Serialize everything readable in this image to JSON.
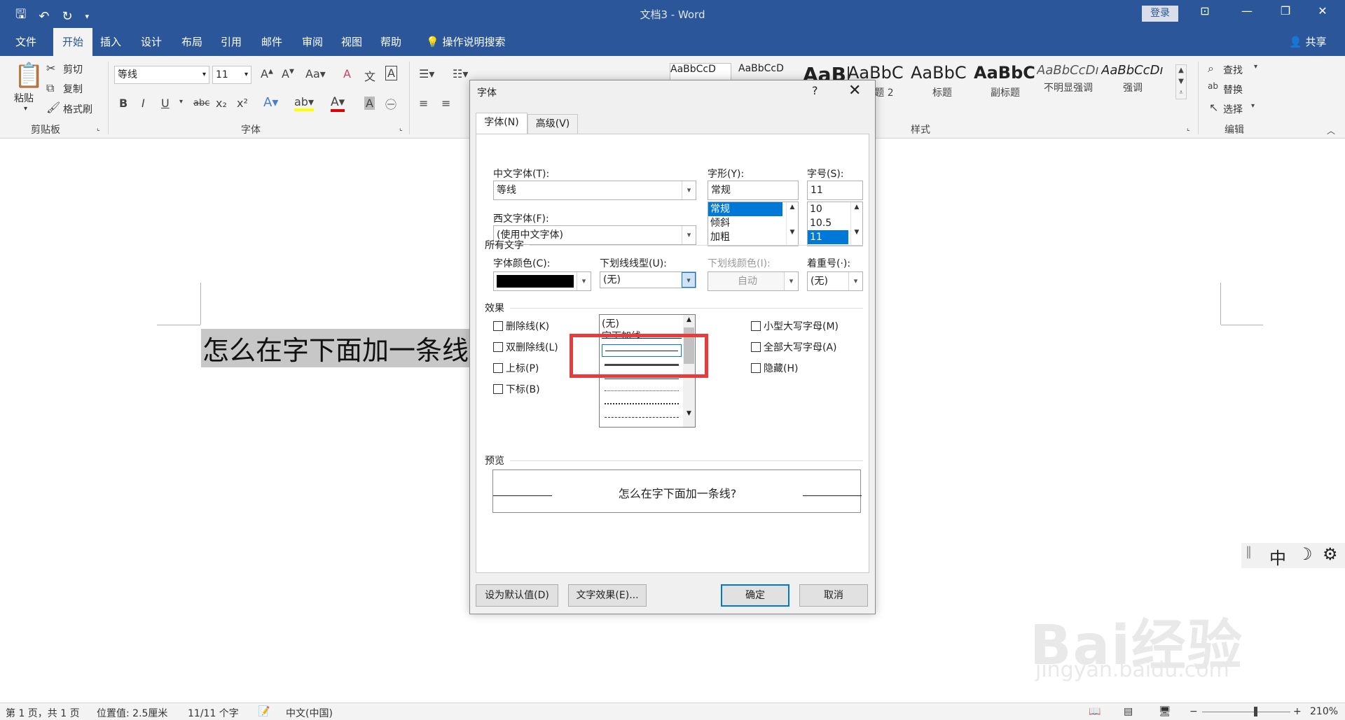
{
  "window": {
    "title": "文档3 - Word",
    "login": "登录"
  },
  "menu": {
    "tabs": [
      "文件",
      "开始",
      "插入",
      "设计",
      "布局",
      "引用",
      "邮件",
      "审阅",
      "视图",
      "帮助"
    ],
    "tell_me": "操作说明搜索",
    "share": "共享"
  },
  "ribbon": {
    "clipboard": {
      "paste": "粘贴",
      "cut": "剪切",
      "copy": "复制",
      "format_painter": "格式刷",
      "label": "剪贴板"
    },
    "font": {
      "name": "等线",
      "size": "11",
      "label": "字体",
      "bold": "B",
      "italic": "I",
      "underline": "U",
      "strike": "abc",
      "sub": "x₂",
      "sup": "x²"
    },
    "styles": {
      "label": "样式",
      "items": [
        {
          "sample": "AaBbCcD",
          "name": ""
        },
        {
          "sample": "AaBbCcD",
          "name": ""
        },
        {
          "sample": "AaBl",
          "name": ""
        },
        {
          "sample": "AaBbC",
          "name": "标题 2"
        },
        {
          "sample": "AaBbC",
          "name": "标题"
        },
        {
          "sample": "AaBbC",
          "name": "副标题"
        },
        {
          "sample": "AaBbCcDı",
          "name": "不明显强调"
        },
        {
          "sample": "AaBbCcDı",
          "name": "强调"
        }
      ]
    },
    "editing": {
      "find": "查找",
      "replace": "替换",
      "select": "选择",
      "label": "编辑"
    }
  },
  "document": {
    "text": "怎么在字下面加一条线"
  },
  "dialog": {
    "title": "字体",
    "help": "?",
    "tabs": [
      "字体(N)",
      "高级(V)"
    ],
    "cn_font_label": "中文字体(T):",
    "cn_font_value": "等线",
    "west_font_label": "西文字体(F):",
    "west_font_value": "(使用中文字体)",
    "style_label": "字形(Y):",
    "style_value": "常规",
    "style_options": [
      "常规",
      "倾斜",
      "加粗"
    ],
    "size_label": "字号(S):",
    "size_value": "11",
    "size_options": [
      "10",
      "10.5",
      "11"
    ],
    "all_text_label": "所有文字",
    "color_label": "字体颜色(C):",
    "color_value": "#000000",
    "underline_style_label": "下划线线型(U):",
    "underline_style_value": "(无)",
    "underline_color_label": "下划线颜色(I):",
    "underline_color_value": "自动",
    "emphasis_label": "着重号(·):",
    "emphasis_value": "(无)",
    "underline_options": [
      "(无)",
      "字下加线"
    ],
    "effects_label": "效果",
    "effects_left": [
      "删除线(K)",
      "双删除线(L)",
      "上标(P)",
      "下标(B)"
    ],
    "effects_right": [
      "小型大写字母(M)",
      "全部大写字母(A)",
      "隐藏(H)"
    ],
    "preview_label": "预览",
    "preview_text": "怎么在字下面加一条线?",
    "buttons": {
      "set_default": "设为默认值(D)",
      "text_effects": "文字效果(E)...",
      "ok": "确定",
      "cancel": "取消"
    }
  },
  "ime": {
    "mode": "中"
  },
  "status": {
    "page": "第 1 页，共 1 页",
    "position": "位置值: 2.5厘米",
    "words": "11/11 个字",
    "lang": "中文(中国)",
    "zoom": "210%"
  },
  "watermark": {
    "logo": "Bai经验",
    "url": "jingyan.baidu.com"
  }
}
